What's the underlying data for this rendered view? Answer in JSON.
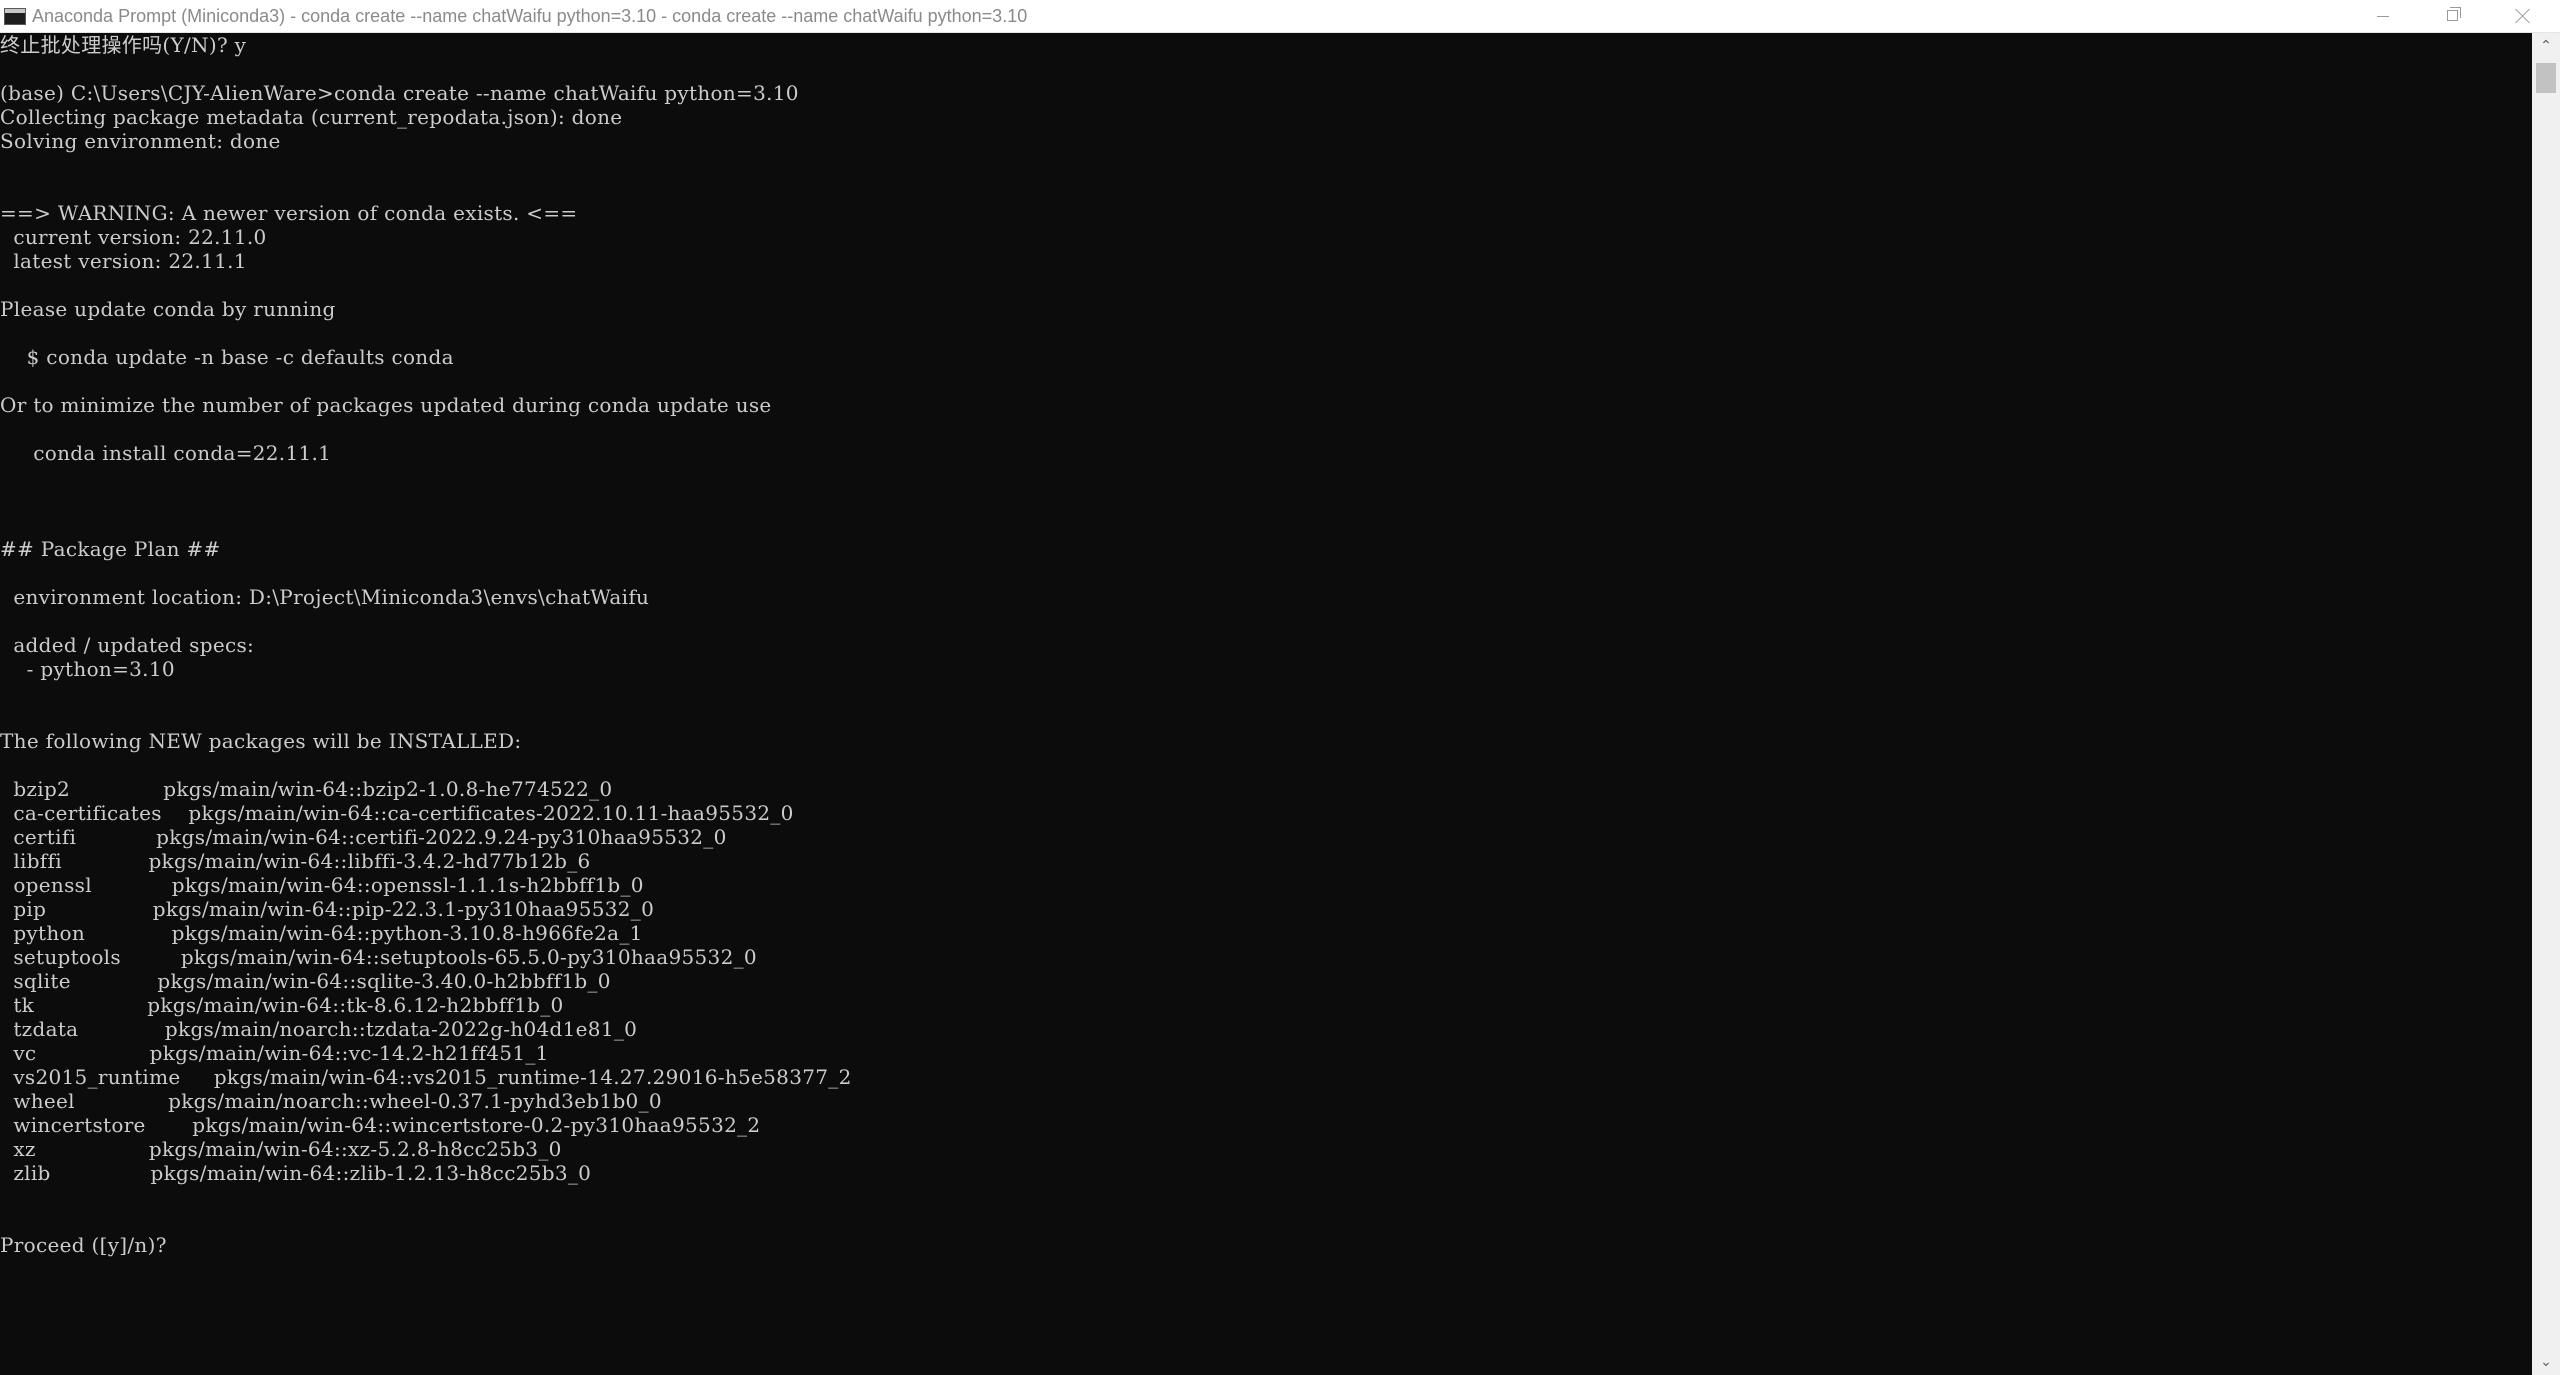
{
  "window": {
    "title": "Anaconda Prompt (Miniconda3) - conda  create --name chatWaifu python=3.10 - conda  create --name chatWaifu python=3.10"
  },
  "icons": {
    "app": "terminal-icon",
    "minimize": "minimize-icon",
    "maximize": "restore-icon",
    "close": "close-icon",
    "scroll_up": "chevron-up-icon",
    "scroll_down": "chevron-down-icon"
  },
  "colors": {
    "console_background": "#0c0c0c",
    "console_text": "#cccccc",
    "titlebar": "#ffffff"
  },
  "console": {
    "lines": [
      "终止批处理操作吗(Y/N)? y",
      "",
      "(base) C:\\Users\\CJY-AlienWare>conda create --name chatWaifu python=3.10",
      "Collecting package metadata (current_repodata.json): done",
      "Solving environment: done",
      "",
      "",
      "==> WARNING: A newer version of conda exists. <==",
      "  current version: 22.11.0",
      "  latest version: 22.11.1",
      "",
      "Please update conda by running",
      "",
      "    $ conda update -n base -c defaults conda",
      "",
      "Or to minimize the number of packages updated during conda update use",
      "",
      "     conda install conda=22.11.1",
      "",
      "",
      "",
      "## Package Plan ##",
      "",
      "  environment location: D:\\Project\\Miniconda3\\envs\\chatWaifu",
      "",
      "  added / updated specs:",
      "    - python=3.10",
      "",
      "",
      "The following NEW packages will be INSTALLED:",
      "",
      "  bzip2              pkgs/main/win-64::bzip2-1.0.8-he774522_0",
      "  ca-certificates    pkgs/main/win-64::ca-certificates-2022.10.11-haa95532_0",
      "  certifi            pkgs/main/win-64::certifi-2022.9.24-py310haa95532_0",
      "  libffi             pkgs/main/win-64::libffi-3.4.2-hd77b12b_6",
      "  openssl            pkgs/main/win-64::openssl-1.1.1s-h2bbff1b_0",
      "  pip                pkgs/main/win-64::pip-22.3.1-py310haa95532_0",
      "  python             pkgs/main/win-64::python-3.10.8-h966fe2a_1",
      "  setuptools         pkgs/main/win-64::setuptools-65.5.0-py310haa95532_0",
      "  sqlite             pkgs/main/win-64::sqlite-3.40.0-h2bbff1b_0",
      "  tk                 pkgs/main/win-64::tk-8.6.12-h2bbff1b_0",
      "  tzdata             pkgs/main/noarch::tzdata-2022g-h04d1e81_0",
      "  vc                 pkgs/main/win-64::vc-14.2-h21ff451_1",
      "  vs2015_runtime     pkgs/main/win-64::vs2015_runtime-14.27.29016-h5e58377_2",
      "  wheel              pkgs/main/noarch::wheel-0.37.1-pyhd3eb1b0_0",
      "  wincertstore       pkgs/main/win-64::wincertstore-0.2-py310haa95532_2",
      "  xz                 pkgs/main/win-64::xz-5.2.8-h8cc25b3_0",
      "  zlib               pkgs/main/win-64::zlib-1.2.13-h8cc25b3_0",
      "",
      "",
      "Proceed ([y]/n)?"
    ]
  }
}
